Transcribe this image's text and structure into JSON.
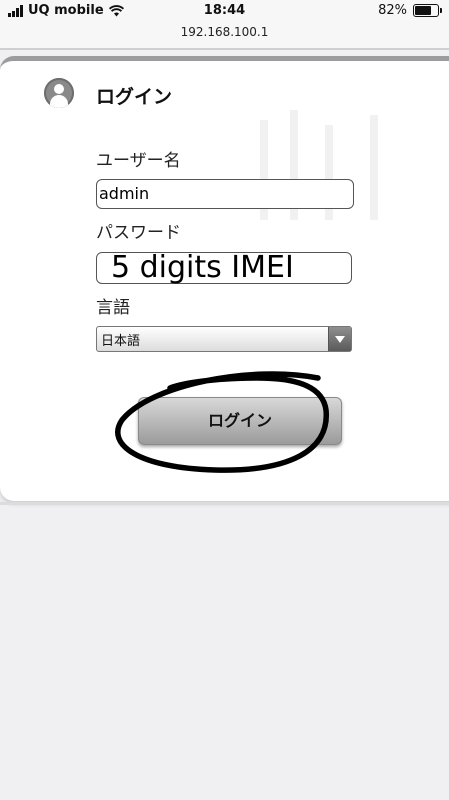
{
  "status_bar": {
    "carrier": "UQ mobile",
    "time": "18:44",
    "battery_percent": "82%",
    "battery_level": 0.82
  },
  "url_bar": {
    "address": "192.168.100.1"
  },
  "login_form": {
    "title": "ログイン",
    "username_label": "ユーザー名",
    "username_value": "admin",
    "password_label": "パスワード",
    "password_annotation": "5 digits IMEI",
    "language_label": "言語",
    "language_selected": "日本語",
    "login_button": "ログイン"
  },
  "icons": {
    "user": "user-avatar-icon",
    "dropdown": "chevron-down-icon",
    "wifi": "wifi-icon",
    "signal": "signal-bars-icon",
    "battery": "battery-icon"
  },
  "colors": {
    "background": "#f0f0f2",
    "panel": "#ffffff",
    "panel_border": "#9c9c9c",
    "button": "#b8b8b8",
    "annotation": "#000000"
  }
}
